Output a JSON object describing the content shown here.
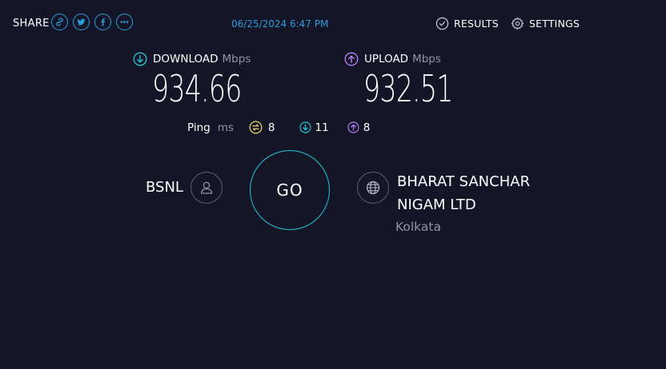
{
  "topbar": {
    "share_label": "SHARE",
    "timestamp": "06/25/2024 6:47 PM",
    "results_label": "RESULTS",
    "settings_label": "SETTINGS"
  },
  "download": {
    "label": "DOWNLOAD",
    "unit": "Mbps",
    "value": "934.66"
  },
  "upload": {
    "label": "UPLOAD",
    "unit": "Mbps",
    "value": "932.51"
  },
  "ping": {
    "label": "Ping",
    "unit": "ms",
    "idle": "8",
    "download": "11",
    "upload": "8"
  },
  "isp": {
    "name": "BSNL"
  },
  "server": {
    "name": "BHARAT SANCHAR NIGAM LTD",
    "location": "Kolkata"
  },
  "go_label": "GO",
  "colors": {
    "background": "#141526",
    "accent_blue": "#2d9cdb",
    "download": "#1fc8d7",
    "upload": "#b67ef5",
    "ping_idle": "#f5d36b"
  }
}
